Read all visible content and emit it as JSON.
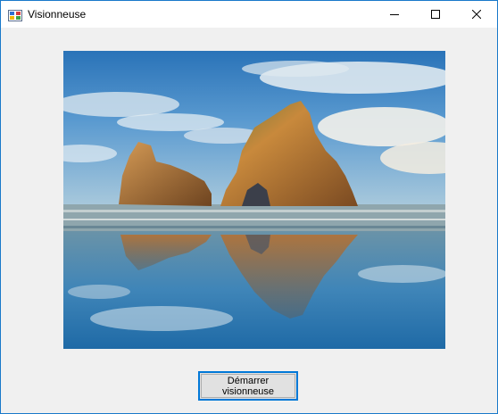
{
  "window": {
    "title": "Visionneuse",
    "icons": {
      "app": "app-icon",
      "minimize": "minimize-icon",
      "maximize": "maximize-icon",
      "close": "close-icon"
    }
  },
  "viewer": {
    "image_subject": "sea-stacks-at-beach-landscape-photo"
  },
  "start_button": {
    "line1": "Démarrer",
    "line2": "visionneuse"
  },
  "colors": {
    "window_border": "#1979ca",
    "button_focus_border": "#0078d7",
    "client_background": "#f0f0f0"
  }
}
